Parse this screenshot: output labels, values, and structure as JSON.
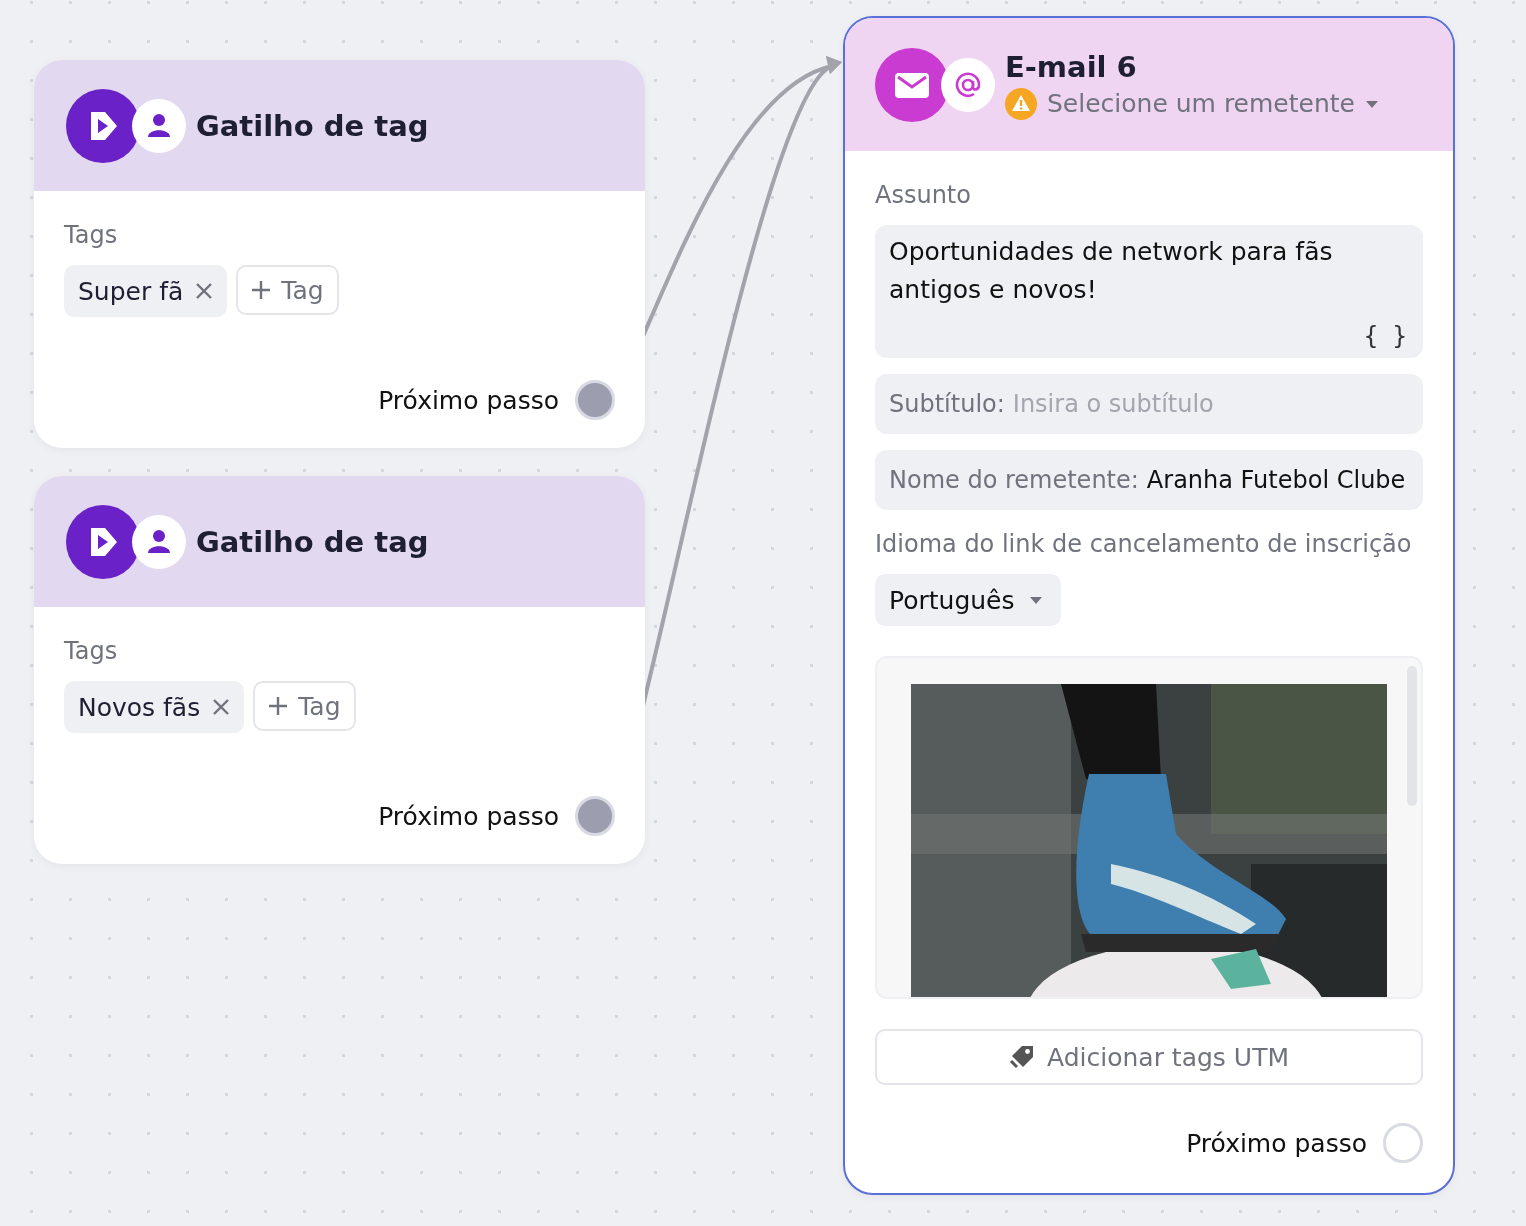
{
  "triggers": [
    {
      "kind": "tag_trigger",
      "title": "Gatilho de tag",
      "section_label": "Tags",
      "tags": [
        {
          "label": "Super fã"
        }
      ],
      "add_tag": "Tag",
      "next_step": "Próximo passo",
      "connected": true
    },
    {
      "kind": "tag_trigger",
      "title": "Gatilho de tag",
      "section_label": "Tags",
      "tags": [
        {
          "label": "Novos fãs"
        }
      ],
      "add_tag": "Tag",
      "next_step": "Próximo passo",
      "connected": true
    }
  ],
  "email": {
    "title": "E-mail 6",
    "sender_select": "Selecione um remetente",
    "sender_warning": true,
    "subject_label": "Assunto",
    "subject": "Oportunidades de network para fãs antigos e novos!",
    "variables_button": "{ }",
    "subtitle_label": "Subtítulo:",
    "subtitle_placeholder": "Insira o subtítulo",
    "sender_name_label": "Nome do remetente:",
    "sender_name": "Aranha Futebol Clube",
    "unsubscribe_label": "Idioma do link de cancelamento de inscrição",
    "language": "Português",
    "utm_button": "Adicionar tags UTM",
    "next_step": "Próximo passo",
    "connected": false
  }
}
